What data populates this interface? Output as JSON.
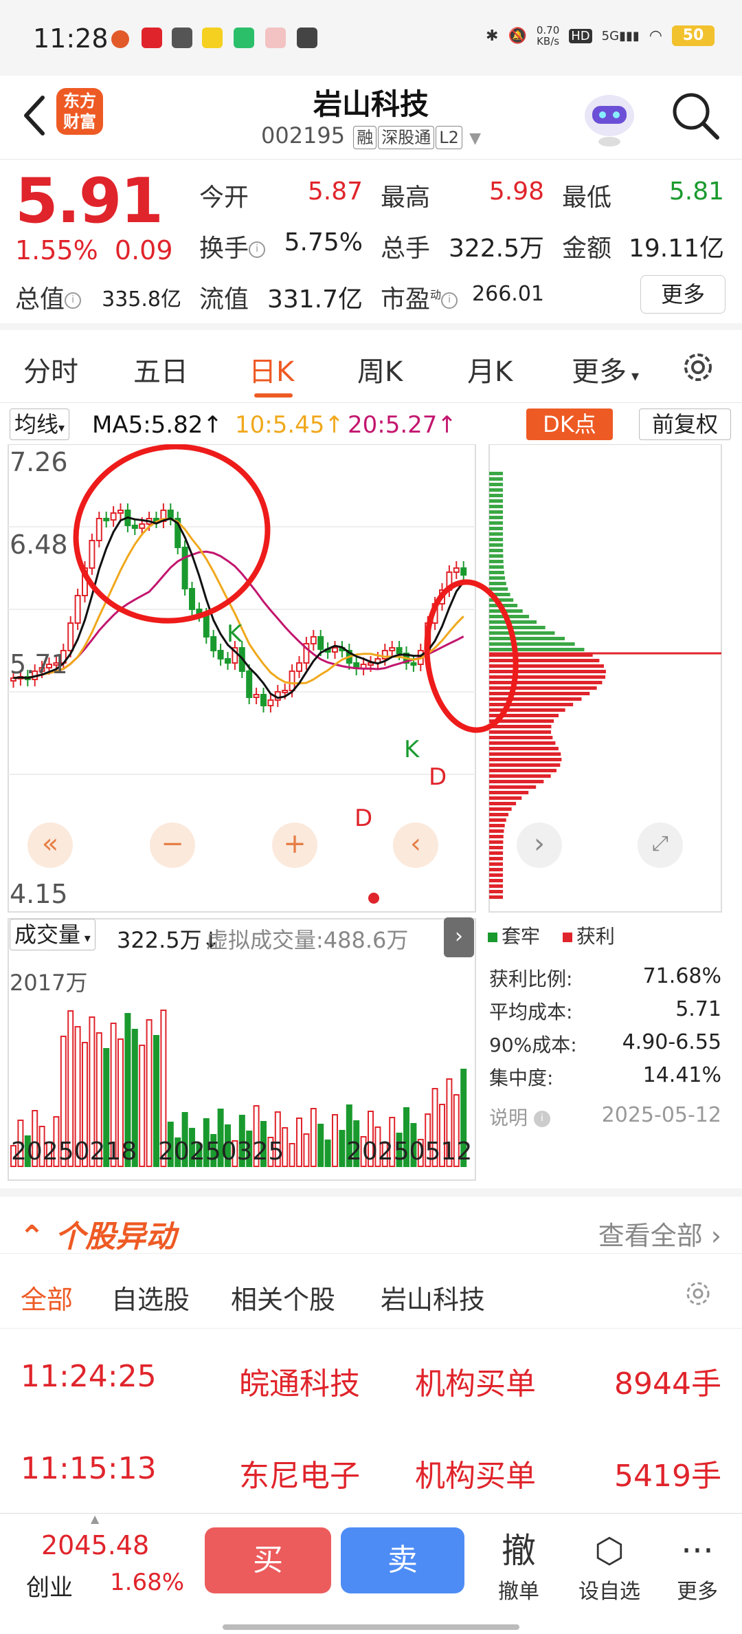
{
  "status": {
    "time": "11:28",
    "net": "0.70\nKB/s",
    "net_top": "0.70",
    "net_unit": "KB/s",
    "hd": "HD",
    "sig": "5G",
    "battery": "50"
  },
  "header": {
    "logo": "东方\n财富",
    "logo_l1": "东方",
    "logo_l2": "财富",
    "title": "岩山科技",
    "code": "002195",
    "tags": [
      "融",
      "深股通",
      "L2"
    ]
  },
  "quote": {
    "price": "5.91",
    "change_pct": "1.55%",
    "change": "0.09",
    "open_label": "今开",
    "open": "5.87",
    "high_label": "最高",
    "high": "5.98",
    "low_label": "最低",
    "low": "5.81",
    "turnover_label": "换手",
    "turnover": "5.75%",
    "volume_label": "总手",
    "volume": "322.5万",
    "amount_label": "金额",
    "amount": "19.11亿",
    "mktcap_label": "总值",
    "mktcap": "335.8亿",
    "float_label": "流值",
    "float": "331.7亿",
    "pe_label": "市盈",
    "pe_sup": "动",
    "pe": "266.01",
    "more": "更多"
  },
  "tabs": [
    "分时",
    "五日",
    "日K",
    "周K",
    "月K",
    "更多"
  ],
  "ma": {
    "selector": "均线",
    "ma5": "MA5:5.82↑",
    "ma10": "10:5.45↑",
    "ma20": "20:5.27↑",
    "dk": "DK点",
    "adjust": "前复权"
  },
  "colors": {
    "ma5": "#111111",
    "ma10": "#f0a81c",
    "ma20": "#c2166e",
    "up": "#e0242b",
    "down": "#1a9a2e",
    "accent": "#ee5a24"
  },
  "chart_data": {
    "type": "candlestick",
    "y_ticks": [
      "7.26",
      "6.48",
      "5.71",
      "4.15"
    ],
    "markers": [
      "K",
      "K",
      "D",
      "D"
    ],
    "volume_label": "成交量",
    "volume": "322.5万↓",
    "virtual_volume": "虚拟成交量:488.6万",
    "volume_max": "2017万",
    "x_ticks": [
      "20250218",
      "20250325",
      "20250512"
    ]
  },
  "chip": {
    "legend": [
      "套牢",
      "获利"
    ],
    "stats": [
      {
        "label": "获利比例:",
        "value": "71.68%"
      },
      {
        "label": "平均成本:",
        "value": "5.71"
      },
      {
        "label": "90%成本:",
        "value": "4.90-6.55"
      },
      {
        "label": "集中度:",
        "value": "14.41%"
      }
    ],
    "note": "说明",
    "date": "2025-05-12"
  },
  "movers": {
    "title": "个股异动",
    "view_all": "查看全部",
    "tabs": [
      "全部",
      "自选股",
      "相关个股",
      "岩山科技"
    ],
    "rows": [
      {
        "time": "11:24:25",
        "name": "皖通科技",
        "type": "机构买单",
        "qty": "8944手"
      },
      {
        "time": "11:15:13",
        "name": "东尼电子",
        "type": "机构买单",
        "qty": "5419手"
      }
    ]
  },
  "bottom": {
    "index_value": "2045.48",
    "index_name": "创业",
    "index_pct": "1.68%",
    "buy": "买",
    "sell": "卖",
    "cancel_icon": "撤",
    "cancel": "撤单",
    "watch": "设自选",
    "more": "更多"
  }
}
